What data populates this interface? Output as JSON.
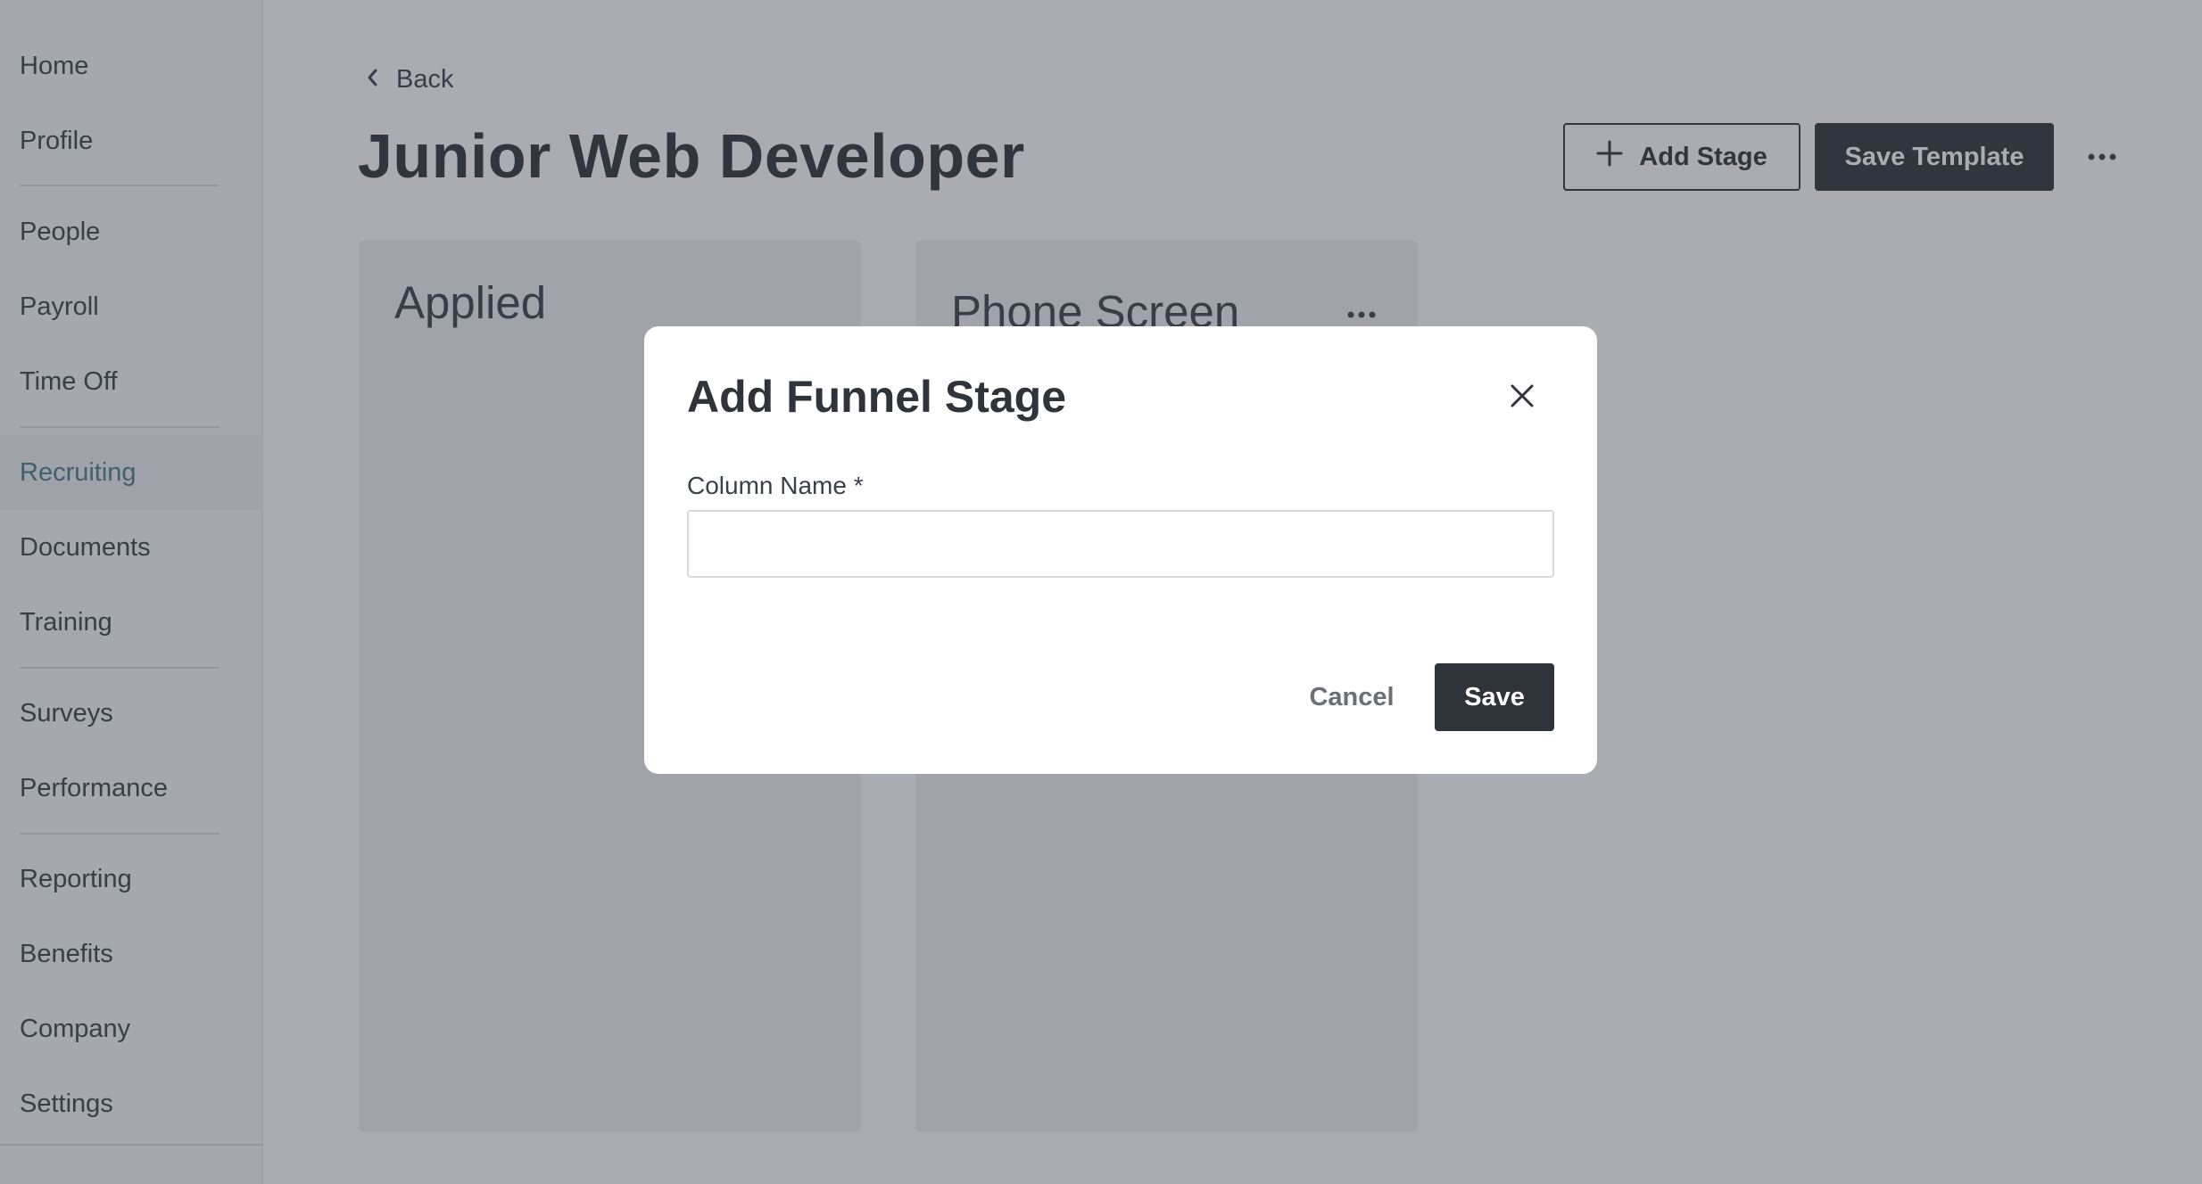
{
  "sidebar": {
    "items": [
      {
        "label": "Home"
      },
      {
        "label": "Profile"
      },
      {
        "label": "People"
      },
      {
        "label": "Payroll"
      },
      {
        "label": "Time Off"
      },
      {
        "label": "Recruiting"
      },
      {
        "label": "Documents"
      },
      {
        "label": "Training"
      },
      {
        "label": "Surveys"
      },
      {
        "label": "Performance"
      },
      {
        "label": "Reporting"
      },
      {
        "label": "Benefits"
      },
      {
        "label": "Company"
      },
      {
        "label": "Settings"
      }
    ],
    "active": "Recruiting"
  },
  "header": {
    "back_label": "Back",
    "title": "Junior Web Developer",
    "add_stage_label": "Add Stage",
    "save_template_label": "Save Template"
  },
  "stages": [
    {
      "title": "Applied"
    },
    {
      "title": "Phone Screen"
    }
  ],
  "modal": {
    "title": "Add Funnel Stage",
    "field_label": "Column Name *",
    "field_value": "",
    "cancel_label": "Cancel",
    "save_label": "Save"
  },
  "colors": {
    "primary_dark": "#2f333a",
    "active_nav": "#4d7d86",
    "overlay": "rgba(52,58,70,0.42)"
  }
}
